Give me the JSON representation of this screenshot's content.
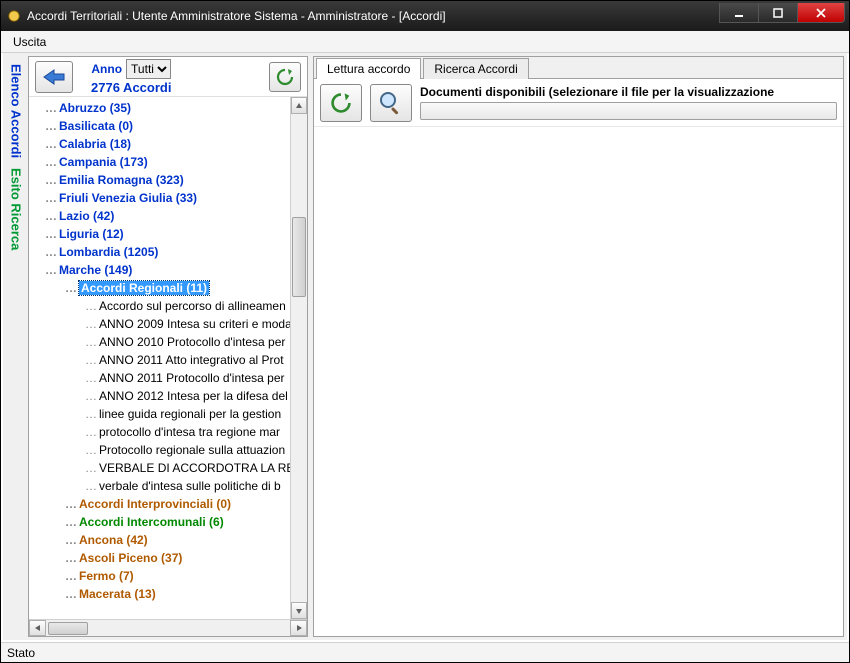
{
  "window": {
    "title": "Accordi Territoriali : Utente Amministratore Sistema - Amministratore - [Accordi]"
  },
  "menubar": {
    "uscita": "Uscita"
  },
  "sidebar_tabs": {
    "elenco_accordi": "Elenco Accordi",
    "esito_ricerca": "Esito Ricerca"
  },
  "toolbar": {
    "anno_label": "Anno",
    "anno_selected": "Tutti",
    "anno_options": [
      "Tutti"
    ],
    "accordi_count": "2776 Accordi"
  },
  "tree": {
    "regions": [
      {
        "label": "Abruzzo (35)",
        "color": "blue"
      },
      {
        "label": "Basilicata (0)",
        "color": "blue"
      },
      {
        "label": "Calabria (18)",
        "color": "blue"
      },
      {
        "label": "Campania (173)",
        "color": "blue"
      },
      {
        "label": "Emilia Romagna (323)",
        "color": "blue"
      },
      {
        "label": "Friuli Venezia Giulia (33)",
        "color": "blue"
      },
      {
        "label": "Lazio (42)",
        "color": "blue"
      },
      {
        "label": "Liguria (12)",
        "color": "blue"
      },
      {
        "label": "Lombardia (1205)",
        "color": "blue"
      },
      {
        "label": "Marche (149)",
        "color": "blue",
        "expanded": true
      }
    ],
    "marche_children": [
      {
        "label": "Accordi Regionali (11)",
        "color": "green",
        "selected": true,
        "expanded": true
      },
      {
        "label": "Accordi Interprovinciali (0)",
        "color": "brown"
      },
      {
        "label": "Accordi Intercomunali (6)",
        "color": "green"
      },
      {
        "label": "Ancona (42)",
        "color": "brown"
      },
      {
        "label": "Ascoli Piceno (37)",
        "color": "brown"
      },
      {
        "label": "Fermo (7)",
        "color": "brown"
      },
      {
        "label": "Macerata (13)",
        "color": "brown"
      }
    ],
    "accordi_regionali_children": [
      "Accordo sul percorso di allineamen",
      "ANNO 2009 Intesa su criteri e moda",
      "ANNO 2010 Protocollo d'intesa per",
      "ANNO 2011 Atto integrativo al Prot",
      "ANNO 2011 Protocollo d'intesa per",
      "ANNO 2012 Intesa per la difesa del",
      "linee guida regionali per la gestion",
      "protocollo d'intesa tra regione mar",
      "Protocollo regionale sulla attuazion",
      "VERBALE DI ACCORDOTRA LA REGIO",
      "verbale d'intesa sulle politiche di b"
    ]
  },
  "right": {
    "tab1": "Lettura accordo",
    "tab2": "Ricerca Accordi",
    "docs_label": "Documenti disponibili (selezionare il file per la visualizzazione"
  },
  "statusbar": {
    "label": "Stato"
  }
}
